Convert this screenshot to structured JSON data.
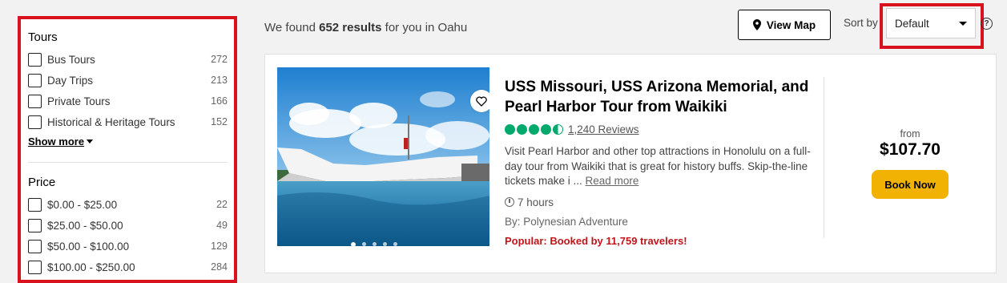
{
  "sidebar": {
    "tours": {
      "title": "Tours",
      "items": [
        {
          "label": "Bus Tours",
          "count": "272"
        },
        {
          "label": "Day Trips",
          "count": "213"
        },
        {
          "label": "Private Tours",
          "count": "166"
        },
        {
          "label": "Historical & Heritage Tours",
          "count": "152"
        }
      ],
      "show_more": "Show more"
    },
    "price": {
      "title": "Price",
      "items": [
        {
          "label": "$0.00 - $25.00",
          "count": "22"
        },
        {
          "label": "$25.00 - $50.00",
          "count": "49"
        },
        {
          "label": "$50.00 - $100.00",
          "count": "129"
        },
        {
          "label": "$100.00 - $250.00",
          "count": "284"
        }
      ]
    }
  },
  "header": {
    "results_prefix": "We found ",
    "results_count": "652 results",
    "results_suffix": " for you in Oahu",
    "view_map": "View Map",
    "sort_label": "Sort by",
    "sort_value": "Default",
    "help": "?"
  },
  "listing": {
    "title": "USS Missouri, USS Arizona Memorial, and Pearl Harbor Tour from Waikiki",
    "rating_bubbles": 4.5,
    "reviews": "1,240 Reviews",
    "description": "Visit Pearl Harbor and other top attractions in Honolulu on a full-day tour from Waikiki that is great for history buffs. Skip-the-line tickets make i ...",
    "read_more": "Read more",
    "duration": "7 hours",
    "by": "By: Polynesian Adventure",
    "popular": "Popular: Booked by 11,759 travelers!",
    "from": "from",
    "price": "$107.70",
    "book_now": "Book Now",
    "carousel": {
      "count": 5,
      "active": 0
    }
  },
  "colors": {
    "highlight": "#d8121f",
    "rating": "#00aa6c",
    "book_button": "#f2b203",
    "popular": "#c0141b"
  },
  "icons": {
    "map": "map-pin-icon",
    "sort": "caret-down-icon",
    "help": "help-icon",
    "favorite": "heart-icon",
    "duration": "clock-icon"
  }
}
